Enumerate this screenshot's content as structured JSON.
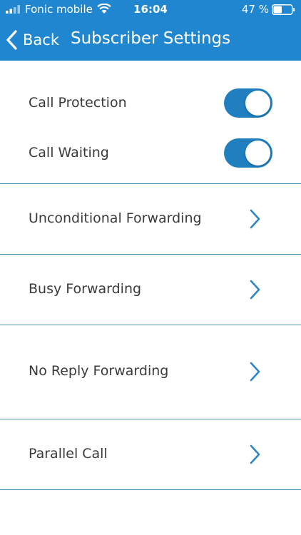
{
  "status_bar": {
    "carrier": "Fonic mobile",
    "time": "16:04",
    "battery_percent": "47 %",
    "battery_level": 0.47,
    "signal_icon": "signal-bars-icon",
    "wifi_icon": "wifi-icon",
    "battery_icon": "battery-icon"
  },
  "nav_bar": {
    "back_label": "Back",
    "title": "Subscriber Settings",
    "back_icon": "chevron-left-icon"
  },
  "toggles": [
    {
      "label": "Call Protection",
      "enabled": true
    },
    {
      "label": "Call Waiting",
      "enabled": true
    }
  ],
  "menu_items": [
    {
      "label": "Unconditional Forwarding",
      "icon": "chevron-right-icon"
    },
    {
      "label": "Busy Forwarding",
      "icon": "chevron-right-icon"
    },
    {
      "label": "No Reply Forwarding",
      "icon": "chevron-right-icon"
    },
    {
      "label": "Parallel Call",
      "icon": "chevron-right-icon"
    }
  ],
  "colors": {
    "header_bg": "#1f86cf",
    "toggle_on": "#1f7fbf",
    "chevron": "#2e86c7",
    "divider": "#4f8fb0",
    "label_text": "#3a3a3a"
  }
}
